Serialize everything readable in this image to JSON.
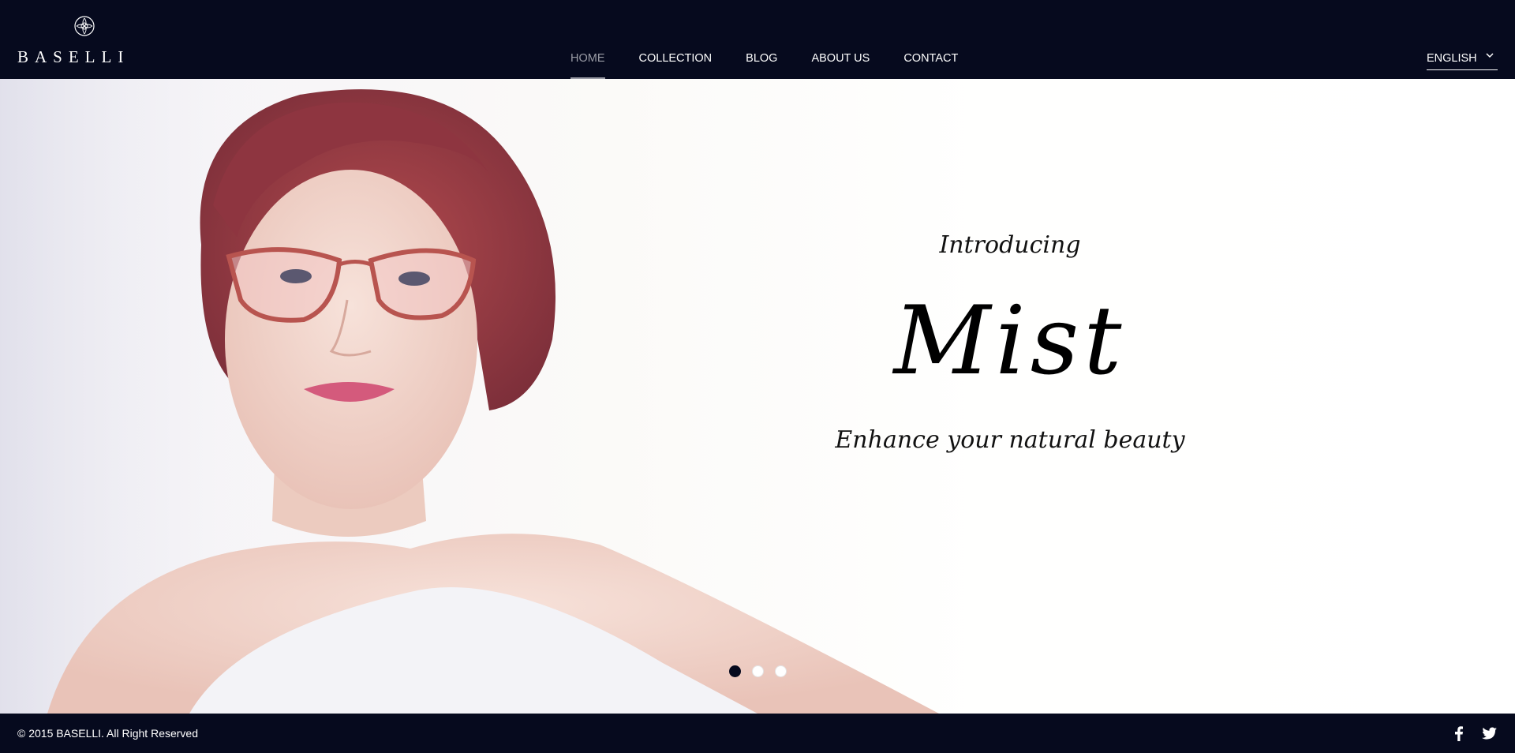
{
  "brand": {
    "name": "BASELLI"
  },
  "nav": {
    "items": [
      {
        "label": "HOME",
        "active": true
      },
      {
        "label": "COLLECTION"
      },
      {
        "label": "BLOG"
      },
      {
        "label": "ABOUT US"
      },
      {
        "label": "CONTACT"
      }
    ]
  },
  "language": {
    "selected": "ENGLISH"
  },
  "hero": {
    "intro": "Introducing",
    "title": "Mist",
    "tagline": "Enhance your natural beauty",
    "slides": {
      "count": 3,
      "active_index": 0
    }
  },
  "footer": {
    "copyright": "© 2015 BASELLI. All Right Reserved",
    "social": [
      "facebook-icon",
      "twitter-icon"
    ]
  },
  "colors": {
    "header_bg": "#060a1e",
    "footer_bg": "#060a1e",
    "nav_active": "#9a9ca6"
  }
}
